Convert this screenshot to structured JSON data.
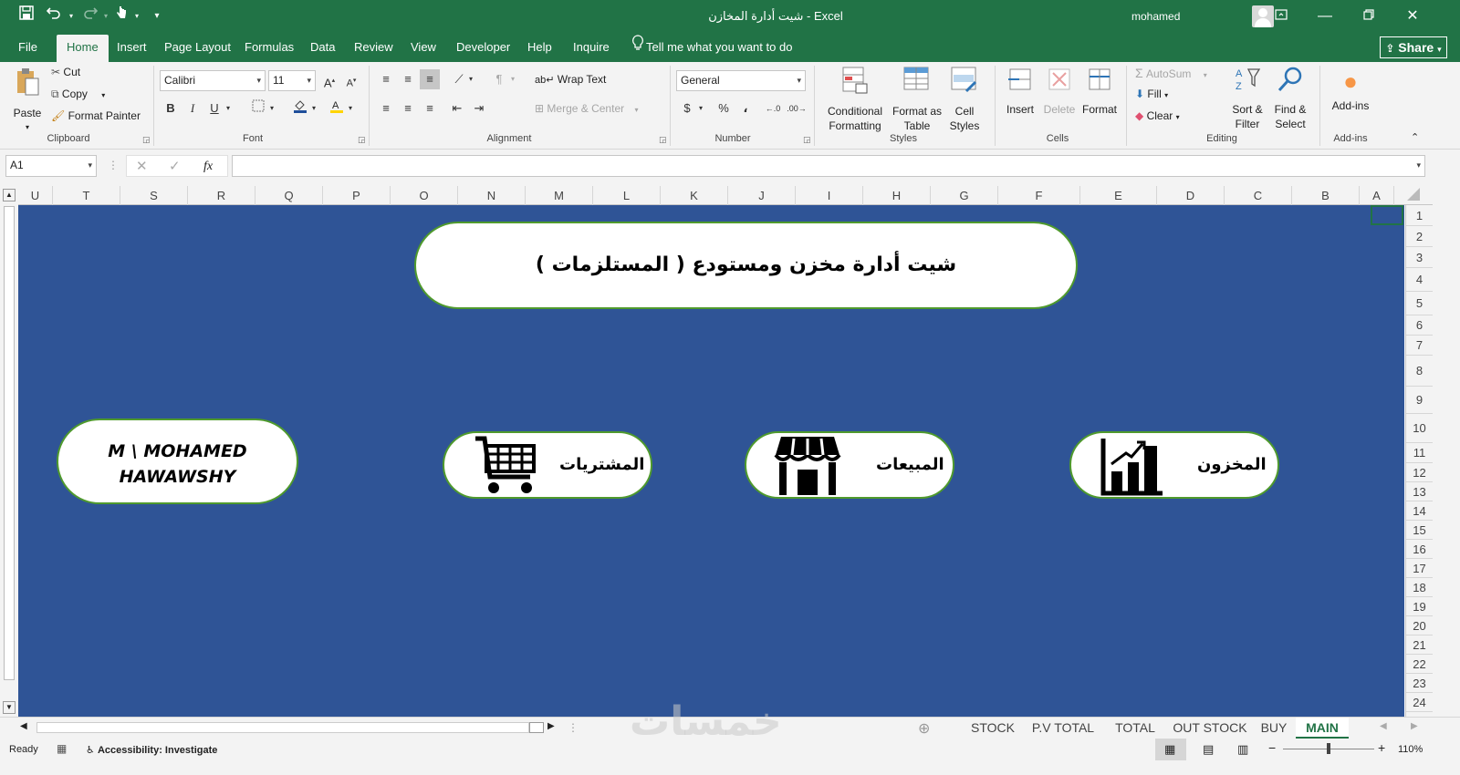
{
  "titlebar": {
    "title": "شيت أدارة المخازن  -  Excel",
    "user": "mohamed hawawshi"
  },
  "menu": {
    "tabs": [
      "File",
      "Home",
      "Insert",
      "Page Layout",
      "Formulas",
      "Data",
      "Review",
      "View",
      "Developer",
      "Help",
      "Inquire"
    ],
    "active": "Home",
    "tell_me": "Tell me what you want to do",
    "share": "Share"
  },
  "ribbon": {
    "clipboard": {
      "paste": "Paste",
      "cut": "Cut",
      "copy": "Copy",
      "format_painter": "Format Painter",
      "label": "Clipboard"
    },
    "font": {
      "name": "Calibri",
      "size": "11",
      "label": "Font",
      "bold": "B",
      "italic": "I",
      "underline": "U"
    },
    "alignment": {
      "wrap_text": "Wrap Text",
      "merge_center": "Merge & Center",
      "label": "Alignment"
    },
    "number": {
      "format": "General",
      "label": "Number",
      "currency": "$",
      "percent": "%",
      "comma": "،"
    },
    "styles": {
      "conditional": "Conditional Formatting",
      "format_table": "Format as Table",
      "cell_styles": "Cell Styles",
      "label": "Styles"
    },
    "cells": {
      "insert": "Insert",
      "delete": "Delete",
      "format": "Format",
      "label": "Cells"
    },
    "editing": {
      "autosum": "AutoSum",
      "fill": "Fill",
      "clear": "Clear",
      "sort_filter": "Sort & Filter",
      "find_select": "Find & Select",
      "label": "Editing"
    },
    "addins": {
      "addins": "Add-ins",
      "label": "Add-ins"
    }
  },
  "formula_bar": {
    "name_box": "A1",
    "fx": "fx",
    "content": ""
  },
  "columns": [
    "U",
    "T",
    "S",
    "R",
    "Q",
    "P",
    "O",
    "N",
    "M",
    "L",
    "K",
    "J",
    "I",
    "H",
    "G",
    "F",
    "E",
    "D",
    "C",
    "B",
    "A"
  ],
  "rows": [
    "1",
    "2",
    "3",
    "4",
    "5",
    "6",
    "7",
    "8",
    "9",
    "10",
    "11",
    "12",
    "13",
    "14",
    "15",
    "16",
    "17",
    "18",
    "19",
    "20",
    "21",
    "22",
    "23",
    "24"
  ],
  "sheet": {
    "background_color": "#2f5496",
    "title": "شيت أدارة مخزن ومستودع ( المستلزمات )",
    "author": "M \\ MOHAMED HAWAWSHY",
    "buttons": {
      "purchases": "المشتريات",
      "sales": "المبيعات",
      "inventory": "المخزون"
    }
  },
  "sheet_tabs": [
    "STOCK",
    "P.V TOTAL",
    "TOTAL",
    "OUT STOCK",
    "BUY",
    "MAIN"
  ],
  "active_sheet": "MAIN",
  "status": {
    "ready": "Ready",
    "accessibility": "Accessibility: Investigate",
    "zoom": "110%"
  },
  "colors": {
    "excel_green": "#217346",
    "pill_border": "#4f9a2d"
  }
}
